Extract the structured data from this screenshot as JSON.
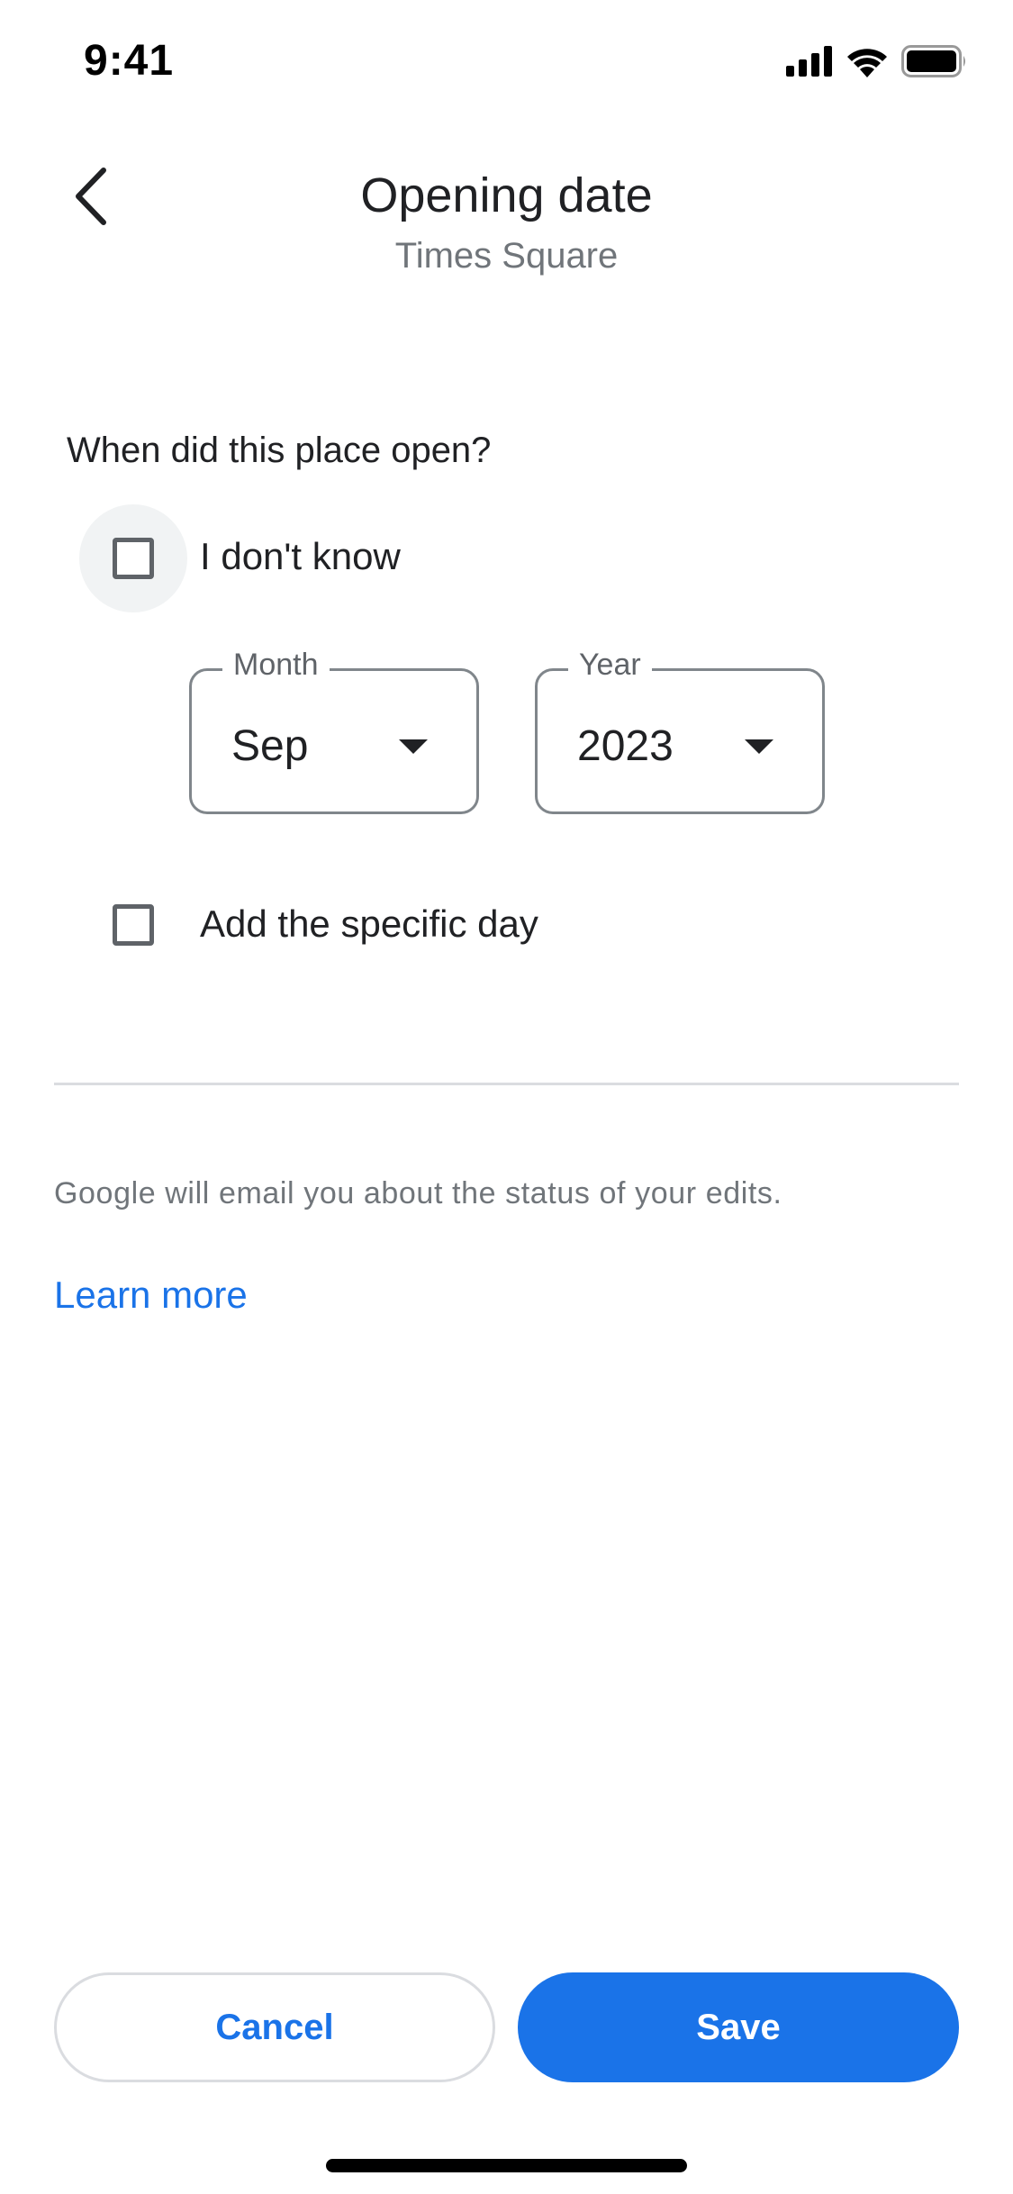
{
  "status_bar": {
    "time": "9:41",
    "icons": [
      "cellular-signal-icon",
      "wifi-icon",
      "battery-icon"
    ]
  },
  "header": {
    "back_icon": "chevron-left-icon",
    "title": "Opening date",
    "subtitle": "Times Square"
  },
  "form": {
    "question": "When did this place open?",
    "dont_know": {
      "label": "I don't know",
      "checked": false
    },
    "month": {
      "label": "Month",
      "value": "Sep",
      "icon": "dropdown-arrow-icon"
    },
    "year": {
      "label": "Year",
      "value": "2023",
      "icon": "dropdown-arrow-icon"
    },
    "specific_day": {
      "label": "Add the specific day",
      "checked": false
    }
  },
  "footer_info": {
    "text": "Google will email you about the status of your edits.",
    "link": "Learn more"
  },
  "actions": {
    "cancel_label": "Cancel",
    "save_label": "Save"
  },
  "colors": {
    "accent": "#1a73e8",
    "text_primary": "#202124",
    "text_secondary": "#70757a",
    "divider": "#dadce0"
  }
}
